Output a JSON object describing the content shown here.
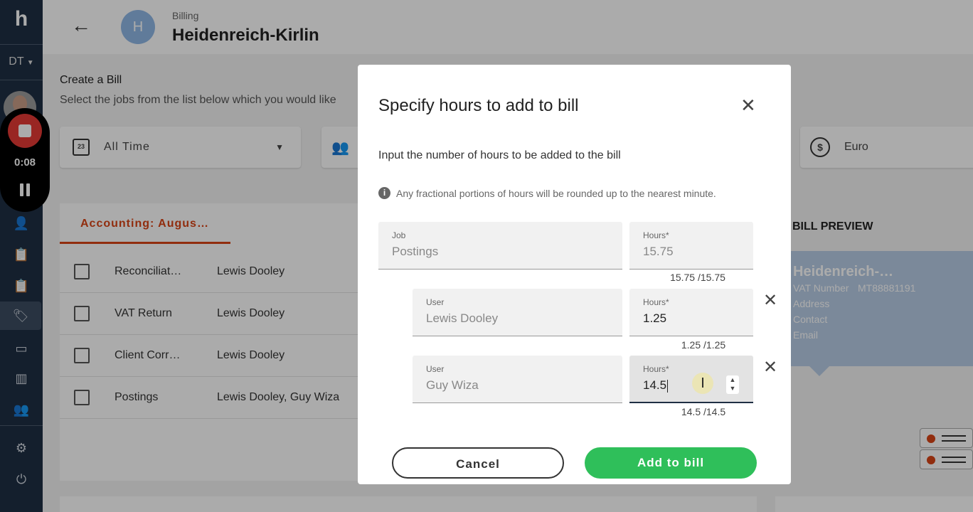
{
  "sidebar": {
    "logo": "h",
    "org": "DT",
    "recorder": {
      "time": "0:08"
    }
  },
  "header": {
    "back_icon": "←",
    "avatar_letter": "H",
    "breadcrumb": "Billing",
    "client_name": "Heidenreich-Kirlin"
  },
  "page": {
    "create_title": "Create a Bill",
    "create_subtitle": "Select the jobs from the list below which you would like",
    "filters": {
      "time_icon_text": "23",
      "time_label": "All Time",
      "currency": "Euro"
    },
    "jobs_tab": "Accounting: Augus…",
    "jobs": [
      {
        "name": "Reconciliat…",
        "users": "Lewis Dooley"
      },
      {
        "name": "VAT Return",
        "users": "Lewis Dooley"
      },
      {
        "name": "Client Corr…",
        "users": "Lewis Dooley"
      },
      {
        "name": "Postings",
        "users": "Lewis Dooley, Guy Wiza"
      }
    ],
    "preview": {
      "title": "BILL PREVIEW",
      "client": "Heidenreich-…",
      "vat_label": "VAT Number",
      "vat_value": "MT88881191",
      "address_label": "Address",
      "contact_label": "Contact",
      "email_label": "Email"
    }
  },
  "modal": {
    "title": "Specify hours to add to bill",
    "subtitle": "Input the number of hours to be added to the bill",
    "info": "Any fractional portions of hours will be rounded up to the nearest minute.",
    "job": {
      "label": "Job",
      "value": "Postings",
      "hours_label": "Hours*",
      "hours_value": "15.75",
      "caption": "15.75 /15.75"
    },
    "users": [
      {
        "label": "User",
        "name": "Lewis Dooley",
        "hours_label": "Hours*",
        "hours": "1.25",
        "caption": "1.25 /1.25"
      },
      {
        "label": "User",
        "name": "Guy Wiza",
        "hours_label": "Hours*",
        "hours": "14.5",
        "caption": "14.5 /14.5"
      }
    ],
    "cancel_label": "Cancel",
    "add_label": "Add to bill"
  }
}
